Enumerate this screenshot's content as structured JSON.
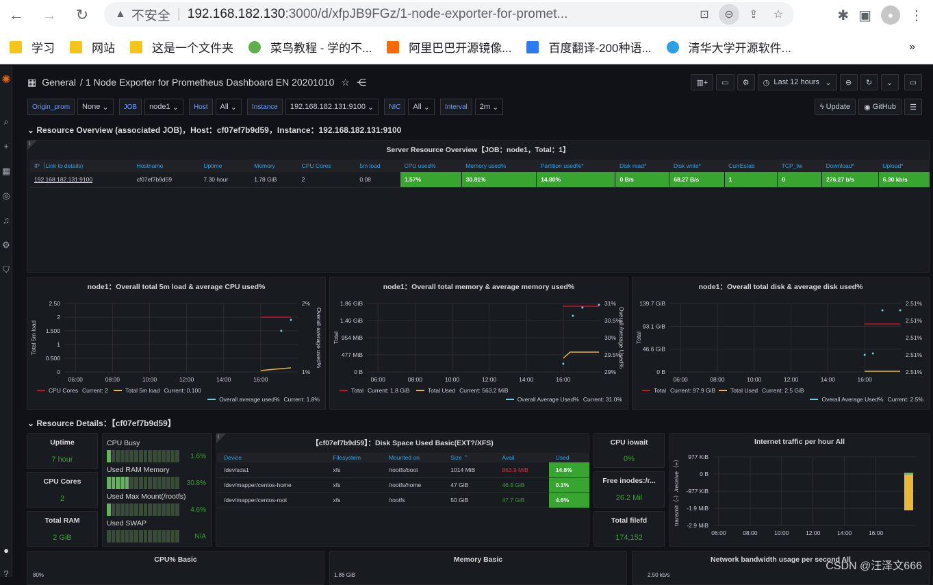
{
  "browser": {
    "url_warning": "不安全",
    "url_host": "192.168.182.130",
    "url_rest": ":3000/d/xfpJB9FGz/1-node-exporter-for-promet...",
    "bookmarks": [
      {
        "label": "学习",
        "type": "folder"
      },
      {
        "label": "网站",
        "type": "folder"
      },
      {
        "label": "这是一个文件夹",
        "type": "folder"
      },
      {
        "label": "菜鸟教程 - 学的不...",
        "type": "runoob"
      },
      {
        "label": "阿里巴巴开源镜像...",
        "type": "aliyun"
      },
      {
        "label": "百度翻译-200种语...",
        "type": "baidu"
      },
      {
        "label": "清华大学开源软件...",
        "type": "tsinghua"
      }
    ],
    "more": "»"
  },
  "dashboard": {
    "breadcrumb_root": "General",
    "title": "1 Node Exporter for Prometheus Dashboard EN 20201010",
    "time_range": "Last 12 hours",
    "update_label": "Update",
    "github_label": "GitHub"
  },
  "variables": [
    {
      "label": "Origin_prom",
      "value": "None"
    },
    {
      "label": "JOB",
      "value": "node1"
    },
    {
      "label": "Host",
      "value": "All"
    },
    {
      "label": "Instance",
      "value": "192.168.182.131:9100"
    },
    {
      "label": "NIC",
      "value": "All"
    },
    {
      "label": "Interval",
      "value": "2m"
    }
  ],
  "row1": "Resource Overview (associated JOB)，Host：cf07ef7b9d59，Instance：192.168.182.131:9100",
  "server_table": {
    "title": "Server Resource Overview【JOB：node1，Total：1】",
    "headers": [
      "IP（Link to details)",
      "Hostname",
      "Uptime",
      "Memory",
      "CPU Cores",
      "5m load",
      "CPU used%",
      "Memory used%",
      "Partition used%*",
      "Disk read*",
      "Disk write*",
      "CurrEstab",
      "TCP_tw",
      "Download*",
      "Upload*"
    ],
    "row": [
      "192.168.182.131:9100",
      "cf07ef7b9d59",
      "7.30 hour",
      "1.78 GiB",
      "2",
      "0.08",
      "1.57%",
      "30.81%",
      "14.80%",
      "0 B/s",
      "68.27 B/s",
      "1",
      "0",
      "276.27 b/s",
      "6.30 kb/s"
    ]
  },
  "chart1": {
    "title": "node1：Overall total 5m load & average CPU used%",
    "left_ticks": [
      "2.50",
      "2",
      "1.500",
      "1",
      "0.500",
      "0"
    ],
    "right_ticks": [
      "2%",
      "1%"
    ],
    "x_ticks": [
      "06:00",
      "08:00",
      "10:00",
      "12:00",
      "14:00",
      "16:00"
    ],
    "ylabel": "Total 5m load",
    "y2label": "Overall average used%",
    "legend": [
      {
        "name": "CPU Cores",
        "current": "Current: 2",
        "color": "#c4162a"
      },
      {
        "name": "Total 5m load",
        "current": "Current: 0.100",
        "color": "#eab839"
      },
      {
        "name": "Overall average used%",
        "current": "Current: 1.8%",
        "color": "#6ed0e0"
      }
    ]
  },
  "chart2": {
    "title": "node1：Overall total memory & average memory used%",
    "left_ticks": [
      "1.86 GiB",
      "1.40 GiB",
      "954 MiB",
      "477 MiB",
      "0 B"
    ],
    "right_ticks": [
      "31%",
      "30.5%",
      "30%",
      "29.5%",
      "29%"
    ],
    "x_ticks": [
      "06:00",
      "08:00",
      "10:00",
      "12:00",
      "14:00",
      "16:00"
    ],
    "ylabel": "Total",
    "y2label": "Overall Average Used%",
    "legend": [
      {
        "name": "Total",
        "current": "Current: 1.8 GiB",
        "color": "#c4162a"
      },
      {
        "name": "Total Used",
        "current": "Current: 563.2 MiB",
        "color": "#eab839"
      },
      {
        "name": "Overall Average Used%",
        "current": "Current: 31.0%",
        "color": "#6ed0e0"
      }
    ]
  },
  "chart3": {
    "title": "node1：Overall total disk & average disk used%",
    "left_ticks": [
      "139.7 GiB",
      "93.1 GiB",
      "46.6 GiB",
      "0 B"
    ],
    "right_ticks": [
      "2.51%",
      "2.51%",
      "2.51%",
      "2.51%",
      "2.51%"
    ],
    "x_ticks": [
      "06:00",
      "08:00",
      "10:00",
      "12:00",
      "14:00",
      "16:00"
    ],
    "ylabel": "Total",
    "y2label": "",
    "legend": [
      {
        "name": "Total",
        "current": "Current: 97.9 GiB",
        "color": "#c4162a"
      },
      {
        "name": "Total Used",
        "current": "Current: 2.5 GiB",
        "color": "#eab839"
      },
      {
        "name": "Overall Average Used%",
        "current": "Current: 2.5%",
        "color": "#6ed0e0"
      }
    ]
  },
  "row2": "Resource Details：【cf07ef7b9d59】",
  "stats": {
    "uptime": {
      "title": "Uptime",
      "value": "7 hour"
    },
    "cpu_cores": {
      "title": "CPU Cores",
      "value": "2"
    },
    "total_ram": {
      "title": "Total RAM",
      "value": "2 GiB"
    },
    "cpu_iowait": {
      "title": "CPU iowait",
      "value": "0%"
    },
    "free_inodes": {
      "title": "Free inodes:/r...",
      "value": "26.2 Mil"
    },
    "total_filefd": {
      "title": "Total filefd",
      "value": "174,152"
    }
  },
  "gauges": [
    {
      "label": "CPU Busy",
      "value": "1.6%",
      "level": 0.016
    },
    {
      "label": "Used RAM Memory",
      "value": "30.8%",
      "level": 0.308
    },
    {
      "label": "Used Max Mount(/rootfs)",
      "value": "4.6%",
      "level": 0.046
    },
    {
      "label": "Used SWAP",
      "value": "N/A",
      "level": 0
    }
  ],
  "disk_table": {
    "title": "【cf07ef7b9d59】：Disk Space Used Basic(EXT?/XFS)",
    "headers": [
      "Device",
      "Filesystem",
      "Mounted on",
      "Size ⌃",
      "Avail",
      "Used"
    ],
    "rows": [
      [
        "/dev/sda1",
        "xfs",
        "/rootfs/boot",
        "1014 MiB",
        "863.9 MiB",
        "14.8%"
      ],
      [
        "/dev/mapper/centos-home",
        "xfs",
        "/rootfs/home",
        "47 GiB",
        "46.9 GiB",
        "0.1%"
      ],
      [
        "/dev/mapper/centos-root",
        "xfs",
        "/rootfs",
        "50 GiB",
        "47.7 GiB",
        "4.6%"
      ]
    ]
  },
  "traffic": {
    "title": "Internet traffic per hour All",
    "y_ticks": [
      "977 KiB",
      "0 B",
      "-977 KiB",
      "-1.9 MiB",
      "-2.9 MiB"
    ],
    "x_ticks": [
      "06:00",
      "08:00",
      "10:00",
      "12:00",
      "14:00",
      "16:00"
    ],
    "ylabel": "transmit（-）/receive（+）"
  },
  "bottom_panels": {
    "cpu_basic": "CPU% Basic",
    "cpu_basic_tick": "80%",
    "memory_basic": "Memory Basic",
    "memory_basic_tick": "1.86 GiB",
    "network_basic": "Network bandwidth usage per second All",
    "network_basic_tick": "2.50 kb/s"
  },
  "watermark": "CSDN @汪泽文666"
}
